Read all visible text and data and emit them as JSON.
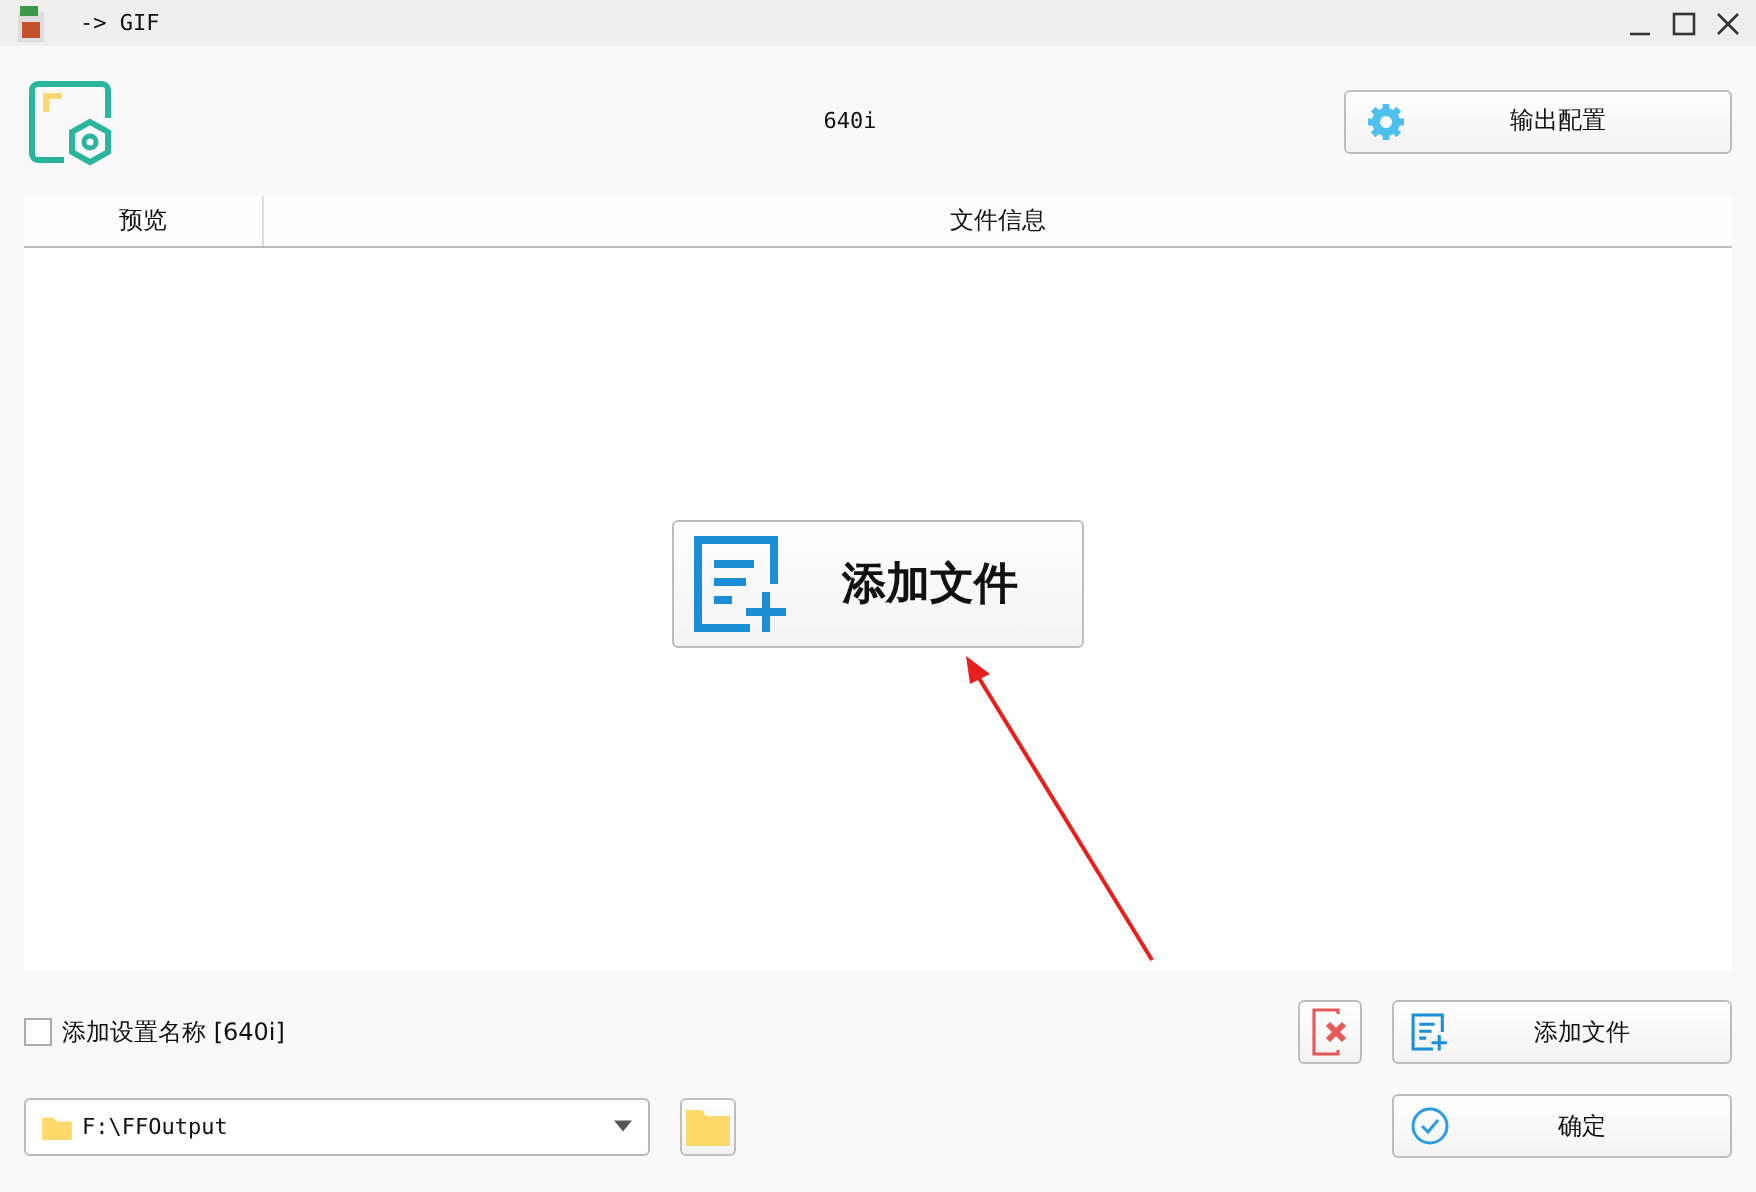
{
  "window": {
    "title": "-> GIF"
  },
  "header": {
    "profile": "640i",
    "config_button": "输出配置"
  },
  "table": {
    "columns": [
      "预览",
      "文件信息"
    ],
    "add_button": "添加文件"
  },
  "options": {
    "checkbox": {
      "label": "添加设置名称 [640i]",
      "checked": false
    },
    "add_file_button": "添加文件",
    "output_path": "F:\\FFOutput",
    "confirm_button": "确定"
  }
}
